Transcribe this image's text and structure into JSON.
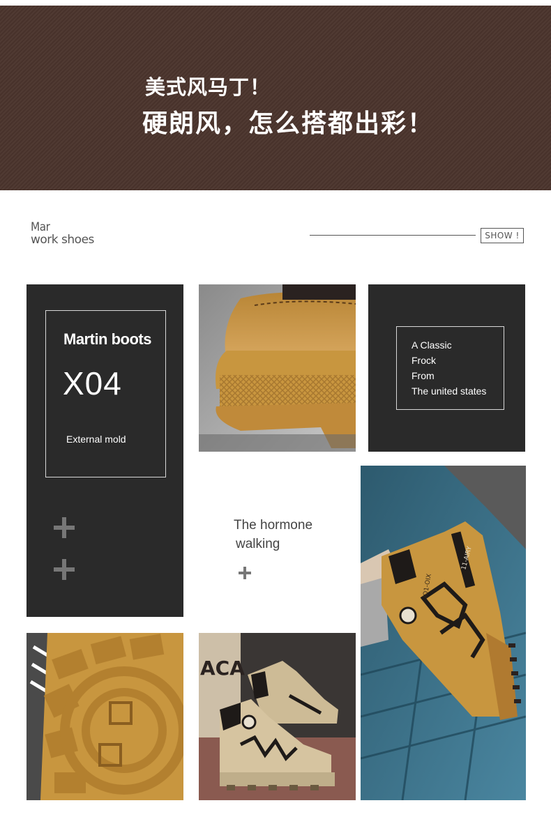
{
  "banner": {
    "line1": "美式风马丁！",
    "line2": "硬朗风，怎么搭都出彩！"
  },
  "section": {
    "line_a": "Mar",
    "line_b": "work shoes",
    "badge": "SHOW !"
  },
  "card_left": {
    "title": "Martin boots",
    "code": "X04",
    "caption": "External mold"
  },
  "card_right": {
    "lines": [
      "A Classic",
      "Frock",
      "From",
      "The united states"
    ]
  },
  "middle": {
    "line1": "The hormone",
    "line2": "walking"
  },
  "photos": {
    "heel_closeup": "boot-heel-closeup-photo",
    "model_wearing": "model-wearing-boot-photo",
    "sole_closeup": "sole-tread-closeup-photo",
    "pair_display": "boot-pair-display-photo",
    "boot_print": "11-AIRY",
    "boot_code": "IO1-OIX"
  },
  "colors": {
    "banner_bg": "#4a342c",
    "panel_dark": "#2a2a2a",
    "boot_tan": "#c8963f",
    "boot_beige": "#cdbb96"
  }
}
